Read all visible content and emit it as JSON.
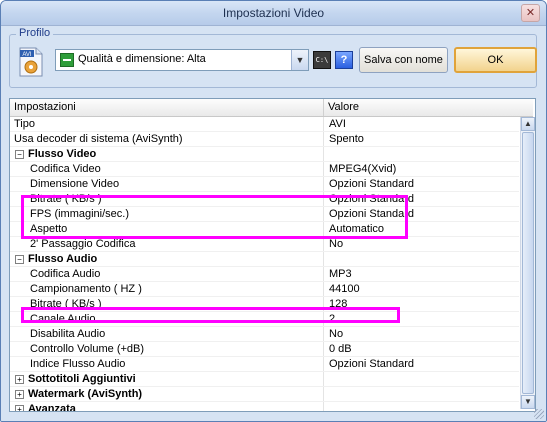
{
  "window": {
    "title": "Impostazioni Video",
    "close_glyph": "✕"
  },
  "profile": {
    "group_label": "Profilo",
    "file_icon_label": "AVI",
    "selected": "Qualità e dimensione: Alta",
    "dropdown_glyph": "▼",
    "cmd_label": "C:\\",
    "help_label": "?",
    "save_as_label": "Salva con nome",
    "ok_label": "OK"
  },
  "grid": {
    "headers": [
      "Impostazioni",
      "Valore"
    ],
    "rows": [
      {
        "name": "Tipo",
        "value": "AVI",
        "level": 0,
        "kind": "item"
      },
      {
        "name": "Usa decoder di sistema (AviSynth)",
        "value": "Spento",
        "level": 0,
        "kind": "item"
      },
      {
        "name": "Flusso Video",
        "value": "",
        "level": 0,
        "kind": "category",
        "expanded": true
      },
      {
        "name": "Codifica Video",
        "value": "MPEG4(Xvid)",
        "level": 1,
        "kind": "item"
      },
      {
        "name": "Dimensione Video",
        "value": "Opzioni Standard",
        "level": 1,
        "kind": "item",
        "highlight": true
      },
      {
        "name": "Bitrate ( KB/s )",
        "value": "Opzioni Standard",
        "level": 1,
        "kind": "item",
        "highlight": true
      },
      {
        "name": "FPS (immagini/sec.)",
        "value": "Opzioni Standard",
        "level": 1,
        "kind": "item",
        "highlight": true
      },
      {
        "name": "Aspetto",
        "value": "Automatico",
        "level": 1,
        "kind": "item"
      },
      {
        "name": "2' Passaggio Codifica",
        "value": "No",
        "level": 1,
        "kind": "item"
      },
      {
        "name": "Flusso Audio",
        "value": "",
        "level": 0,
        "kind": "category",
        "expanded": true
      },
      {
        "name": "Codifica Audio",
        "value": "MP3",
        "level": 1,
        "kind": "item"
      },
      {
        "name": "Campionamento ( HZ )",
        "value": "44100",
        "level": 1,
        "kind": "item"
      },
      {
        "name": "Bitrate ( KB/s )",
        "value": "128",
        "level": 1,
        "kind": "item",
        "highlight": true
      },
      {
        "name": "Canale Audio",
        "value": "2",
        "level": 1,
        "kind": "item"
      },
      {
        "name": "Disabilita Audio",
        "value": "No",
        "level": 1,
        "kind": "item"
      },
      {
        "name": "Controllo Volume (+dB)",
        "value": "0 dB",
        "level": 1,
        "kind": "item"
      },
      {
        "name": "Indice Flusso Audio",
        "value": "Opzioni Standard",
        "level": 1,
        "kind": "item"
      },
      {
        "name": "Sottotitoli Aggiuntivi",
        "value": "",
        "level": 0,
        "kind": "category",
        "expanded": false
      },
      {
        "name": "Watermark (AviSynth)",
        "value": "",
        "level": 0,
        "kind": "category",
        "expanded": false
      },
      {
        "name": "Avanzata",
        "value": "",
        "level": 0,
        "kind": "category",
        "expanded": false
      }
    ]
  },
  "scroll_glyphs": {
    "up": "▲",
    "down": "▼"
  },
  "colors": {
    "highlight": "#ff00ff",
    "ok_border": "#e0a33a"
  },
  "icons": [
    "avi-file-icon",
    "profile-quality-icon",
    "command-line-icon",
    "help-icon",
    "close-icon"
  ]
}
